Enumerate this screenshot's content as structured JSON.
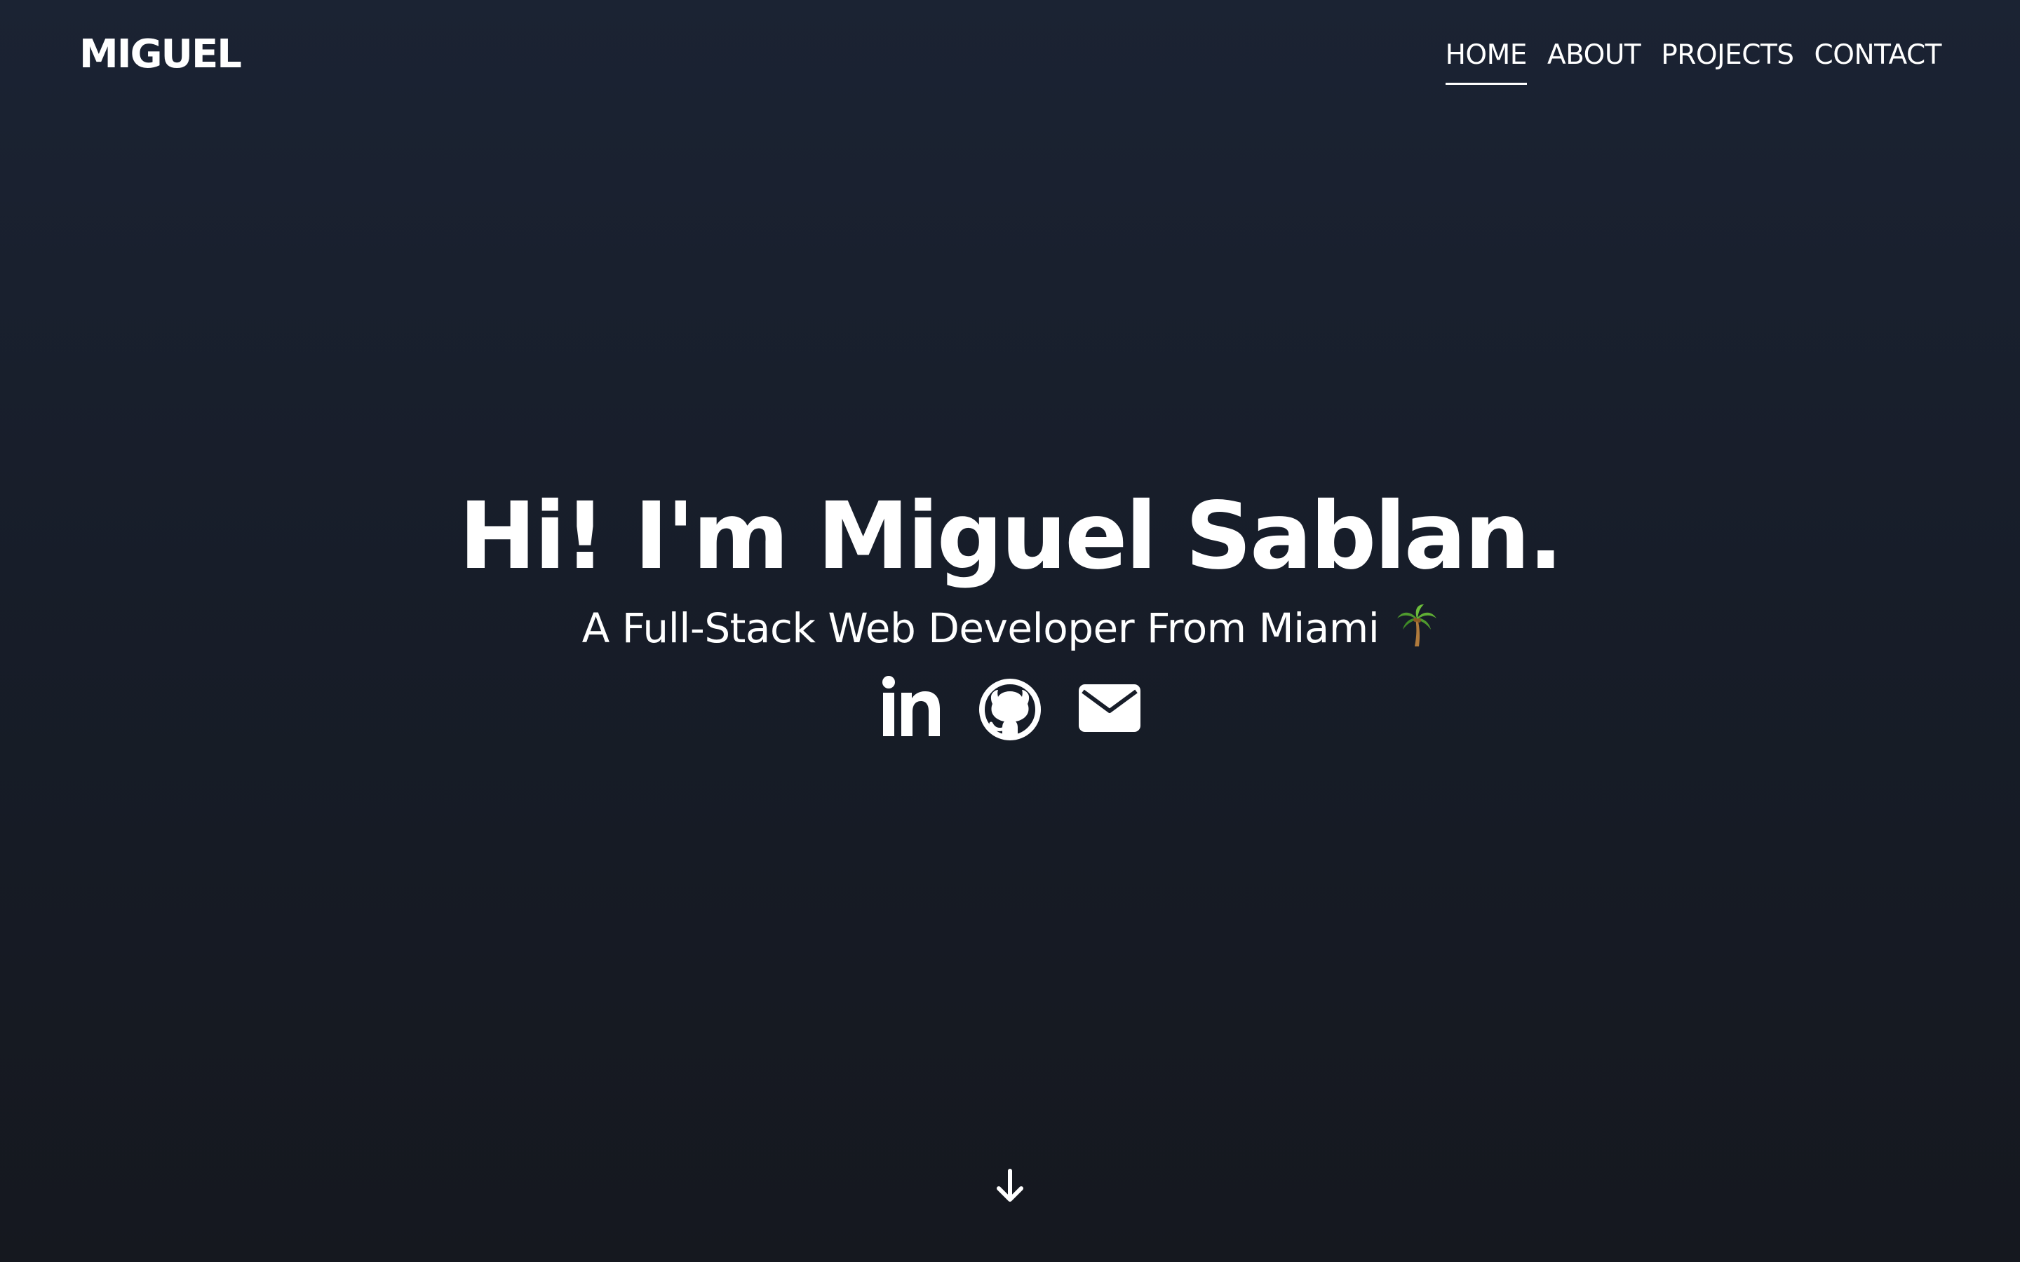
{
  "header": {
    "logo": "MIGUEL",
    "nav": [
      {
        "label": "HOME",
        "active": true
      },
      {
        "label": "ABOUT",
        "active": false
      },
      {
        "label": "PROJECTS",
        "active": false
      },
      {
        "label": "CONTACT",
        "active": false
      }
    ]
  },
  "hero": {
    "title": "Hi! I'm Miguel Sablan.",
    "subtitle": "A Full-Stack Web Developer From Miami",
    "subtitle_emoji": "palm-tree-icon",
    "social": [
      {
        "icon": "linkedin-icon"
      },
      {
        "icon": "github-icon"
      },
      {
        "icon": "mail-icon"
      }
    ]
  },
  "scroll": {
    "icon": "arrow-down-icon"
  },
  "colors": {
    "background_top": "#1b2333",
    "background_bottom": "#15181f",
    "text": "#ffffff"
  }
}
